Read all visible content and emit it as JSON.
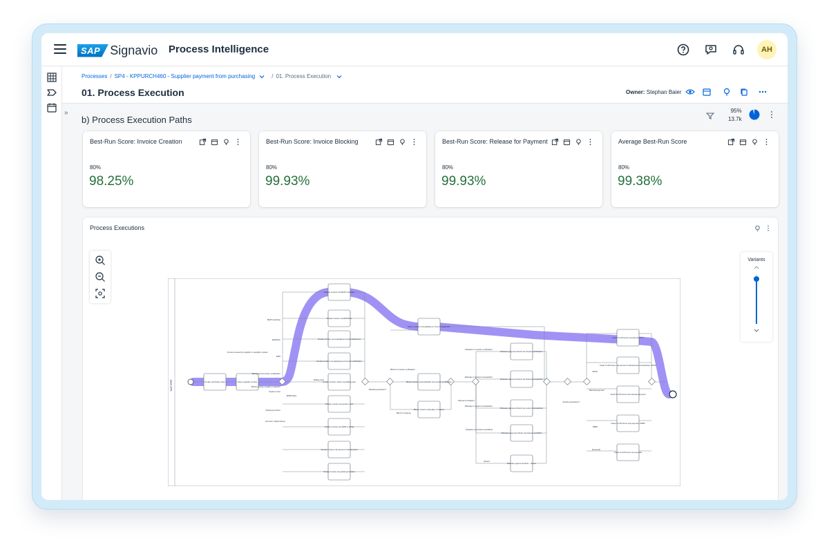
{
  "shell": {
    "brand_badge": "SAP",
    "brand_name": "Signavio",
    "app_title": "Process Intelligence",
    "user_initials": "AH",
    "icons": [
      "menu-icon",
      "help-icon",
      "feedback-icon",
      "headset-icon"
    ],
    "colors": {
      "accent": "#0064d9",
      "avatar_bg": "#fff3b8",
      "frame": "#d3ebf8"
    }
  },
  "breadcrumb": {
    "items": [
      "Processes",
      "SP4 - KPPURCH460 - Supplier payment from purchasing",
      "01. Process Execution"
    ]
  },
  "page": {
    "title": "01. Process Execution",
    "owner_label": "Owner:",
    "owner_name": "Stephan Baier"
  },
  "section": {
    "title": "b) Process Execution Paths",
    "stat_percent": "95%",
    "stat_count": "13.7k",
    "stat_fill": 0.95
  },
  "cards": [
    {
      "title": "Best-Run Score: Invoice Creation",
      "target": "80%",
      "value": "98.25%"
    },
    {
      "title": "Best-Run Score: Invoice Blocking",
      "target": "80%",
      "value": "99.93%"
    },
    {
      "title": "Best-Run Score: Release for Payment",
      "target": "80%",
      "value": "99.93%"
    },
    {
      "title": "Average Best-Run Score",
      "target": "80%",
      "value": "99.38%"
    }
  ],
  "executions": {
    "title": "Process Executions",
    "variants_label": "Variants",
    "variants_level": 0.9,
    "lane_label": "SAP ERP",
    "nodes": {
      "n1": "Create purchase order",
      "n2": "Issue supplier invoice",
      "n3": "Create invoice via BAPI interface",
      "n4": "Create invoice via EDI/IDoc",
      "n5": "Create invoice via evaluated receipt settlement",
      "n6": "Create invoice via background invoice verification",
      "n7": "Create invoice online via dialog user",
      "n8": "Create invoice via system user",
      "n9": "Create invoice via SRM to Ariba",
      "n10": "Create invoice via account maintenance",
      "n11": "Create invoice via parking function",
      "n12": "Move invoice immediately to 'free for payment'",
      "n13": "Block invoice automatically via invoice verification",
      "n14": "Block invoice manually in finance",
      "n15": "Release payment block via invoice verification",
      "n16": "Release payment block via finance transaction",
      "n17": "Release payment block via custom transaction",
      "n18": "Release payment block via finance workflow",
      "n19": "Release payment block - others",
      "n20": "Clear FI-AP items via payment run",
      "n21": "Clear FI-AP items via account maintenance transaction F.B1X",
      "n22": "Clear FI-AP items via manual payment",
      "n23": "Clear FI-AP items via payment F.B05",
      "n24": "Clear FI-AP items via reversal"
    },
    "edge_labels": {
      "bapi": "BAPI interface",
      "edi": "EDI/IDoc",
      "ers": "ERS",
      "bg": "Background invoice verification",
      "dialog": "Dialog user",
      "system": "System user",
      "srm": "SRM/Ariba",
      "parking": "Parking function",
      "account": "Account maintenance",
      "which": "Which invoice creation method?",
      "issued": "Invoice issued by supplier in supplier system",
      "blocking": "Blocking decision?",
      "block_iv": "Block in invoice verification",
      "block_fin": "Block in finance",
      "release_dec": "Payment release?",
      "rel_iv": "Release in invoice verification",
      "rel_ft": "Release in finance transaction",
      "rel_ct": "Release in custom transaction",
      "rel_wf": "Release via finance workflow",
      "others": "Others",
      "clearing": "Clearing decision?",
      "manual": "Manual payment",
      "fb1x": "FB1X",
      "fb05": "FB05",
      "reversal": "Reversal"
    }
  }
}
